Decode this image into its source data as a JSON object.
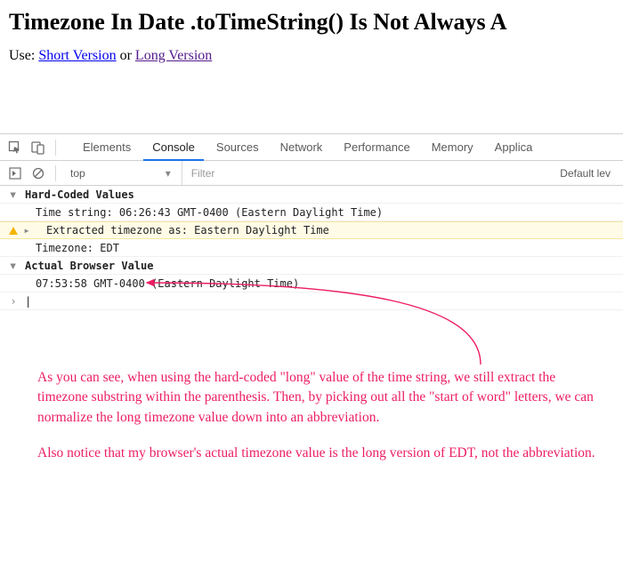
{
  "header": {
    "title": "Timezone In Date .toTimeString() Is Not Always A",
    "use_label": "Use:",
    "link_short": "Short Version",
    "or_label": "or",
    "link_long": "Long Version"
  },
  "devtools": {
    "tabs": [
      "Elements",
      "Console",
      "Sources",
      "Network",
      "Performance",
      "Memory",
      "Applica"
    ],
    "active_tab": "Console",
    "context": "top",
    "filter_placeholder": "Filter",
    "levels_label": "Default lev",
    "console": {
      "group1_label": "Hard-Coded Values",
      "line1": "Time string: 06:26:43 GMT-0400 (Eastern Daylight Time)",
      "line2": "Extracted timezone as: Eastern Daylight Time",
      "line3": "Timezone: EDT",
      "group2_label": "Actual Browser Value",
      "line4": "07:53:58 GMT-0400 (Eastern Daylight Time)"
    }
  },
  "annotation": {
    "p1": "As you can see, when using the hard-coded \"long\" value of the time string, we still extract the timezone substring within the parenthesis. Then, by picking out all the \"start of word\" letters, we can normalize the long timezone value down into an abbreviation.",
    "p2": "Also notice that my browser's actual timezone value is the long version of EDT, not the abbreviation."
  },
  "colors": {
    "accent": "#1a73e8",
    "annotation": "#ec1d64",
    "warn_bg": "#fffbe6"
  }
}
